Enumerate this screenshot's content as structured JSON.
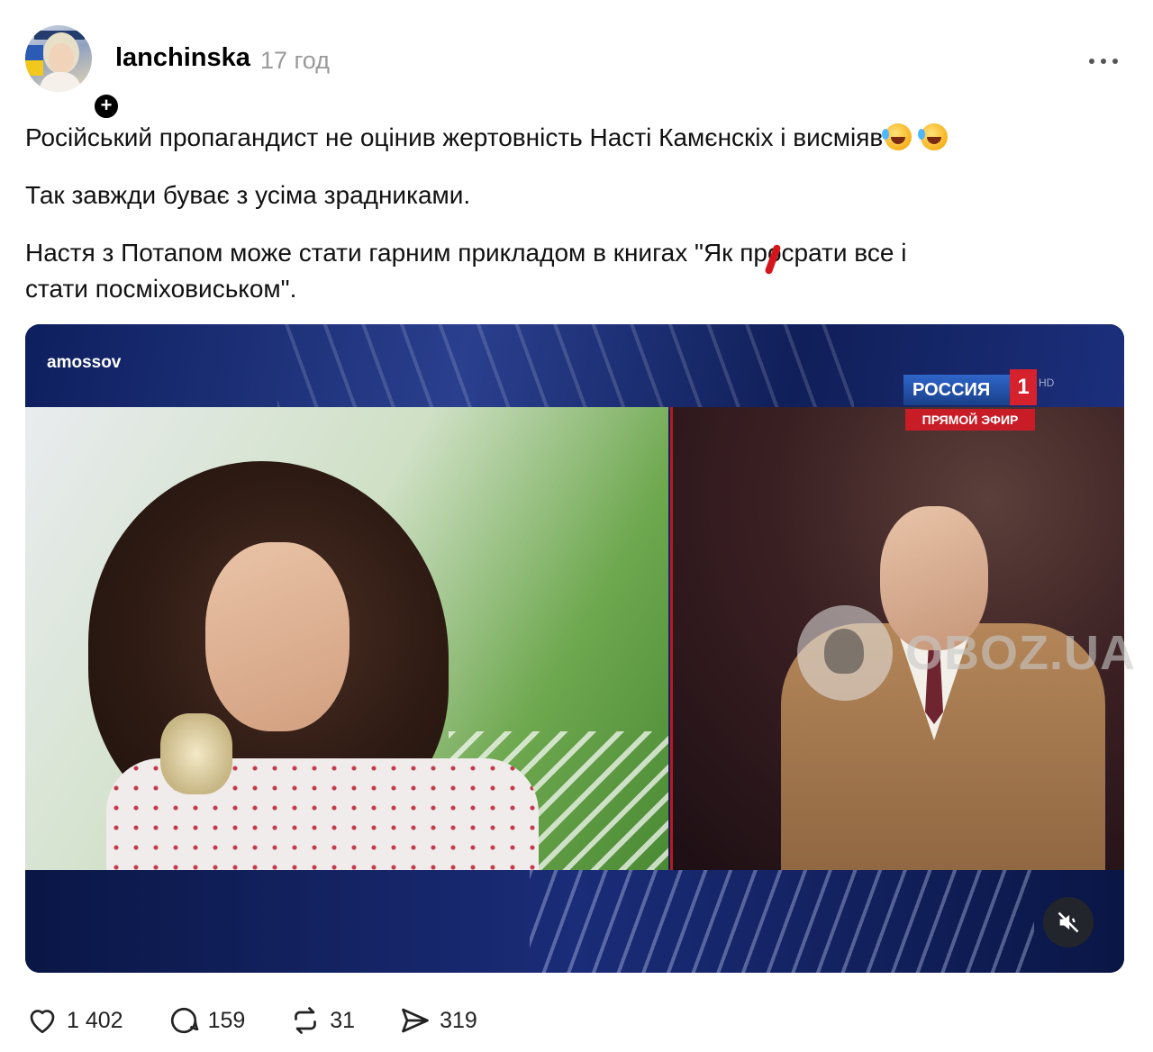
{
  "post": {
    "username": "lanchinska",
    "timestamp": "17 год",
    "paragraphs": [
      "Російський пропагандист не оцінив жертовність Насті Камєнскіх і висміяв",
      "Так завжди буває з усіма зрадниками.",
      "Настя з Потапом може стати гарним прикладом в книгах \"Як пр",
      "срати все і",
      "стати посміховиськом\"."
    ]
  },
  "video": {
    "channel_tag": "amossov",
    "logo_name": "РОССИЯ",
    "logo_number": "1",
    "logo_hd": "HD",
    "logo_live": "ПРЯМОЙ ЭФИР",
    "muted": true
  },
  "watermark": {
    "text": "OBOZ.UA"
  },
  "actions": {
    "likes": "1 402",
    "comments": "159",
    "reposts": "31",
    "shares": "319"
  },
  "icons": {
    "like": "heart-icon",
    "comment": "speech-bubble-icon",
    "repost": "repost-arrows-icon",
    "share": "paper-plane-icon",
    "mute": "speaker-muted-icon",
    "more": "more-dots-icon",
    "follow": "plus-icon",
    "emoji": "rolling-laughing-emoji"
  }
}
